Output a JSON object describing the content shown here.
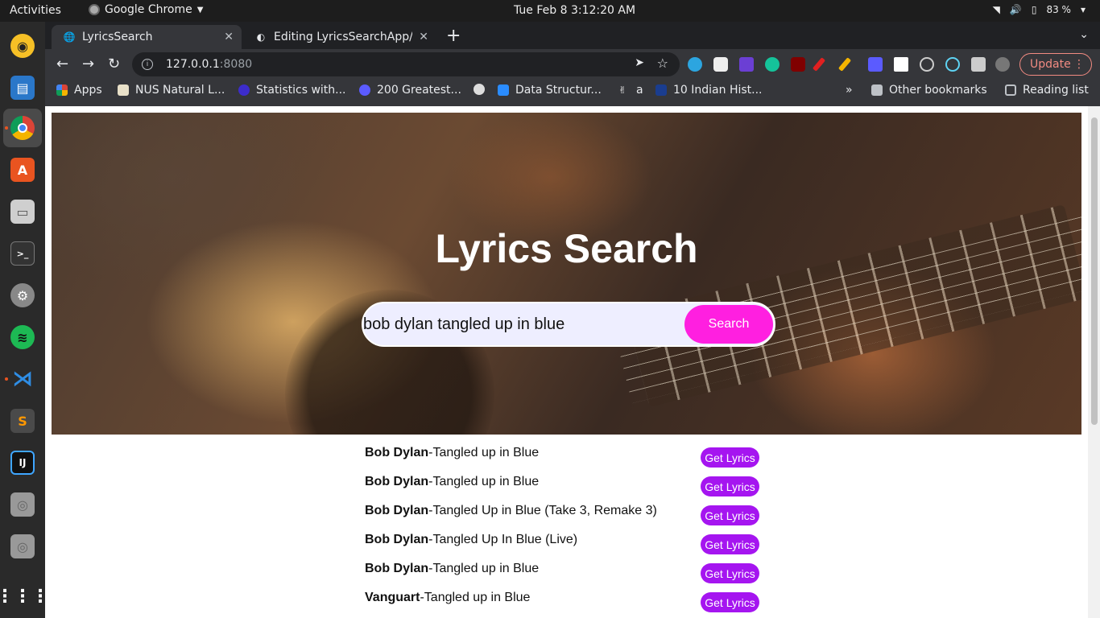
{
  "topbar": {
    "activities": "Activities",
    "app_name": "Google Chrome",
    "clock": "Tue Feb 8   3:12:20 AM",
    "battery": "83 %"
  },
  "browser": {
    "tabs": [
      {
        "title": "LyricsSearch",
        "active": true
      },
      {
        "title": "Editing LyricsSearchApp/",
        "active": false
      }
    ],
    "url_host": "127.0.0.1",
    "url_port": ":8080",
    "update_label": "Update",
    "bookmarks": [
      {
        "label": "Apps"
      },
      {
        "label": "NUS Natural L..."
      },
      {
        "label": "Statistics with..."
      },
      {
        "label": "200 Greatest..."
      },
      {
        "label": "Data Structur..."
      },
      {
        "label": "a"
      },
      {
        "label": "10 Indian Hist..."
      }
    ],
    "overflow": "»",
    "other_bookmarks": "Other bookmarks",
    "reading_list": "Reading list"
  },
  "page": {
    "title": "Lyrics Search",
    "search_value": "bob dylan tangled up in blue",
    "search_button": "Search",
    "results": [
      {
        "artist": "Bob Dylan",
        "song": "-Tangled up in Blue",
        "button": "Get Lyrics"
      },
      {
        "artist": "Bob Dylan",
        "song": "-Tangled up in Blue",
        "button": "Get Lyrics"
      },
      {
        "artist": "Bob Dylan",
        "song": "-Tangled Up in Blue (Take 3, Remake 3)",
        "button": "Get Lyrics"
      },
      {
        "artist": "Bob Dylan",
        "song": "-Tangled Up In Blue (Live)",
        "button": "Get Lyrics"
      },
      {
        "artist": "Bob Dylan",
        "song": "-Tangled up in Blue",
        "button": "Get Lyrics"
      },
      {
        "artist": "Vanguart",
        "song": "-Tangled up in Blue",
        "button": "Get Lyrics"
      }
    ]
  },
  "colors": {
    "search_button": "#ff1fe0",
    "lyrics_button": "#a515f0",
    "update_accent": "#f28b82"
  }
}
